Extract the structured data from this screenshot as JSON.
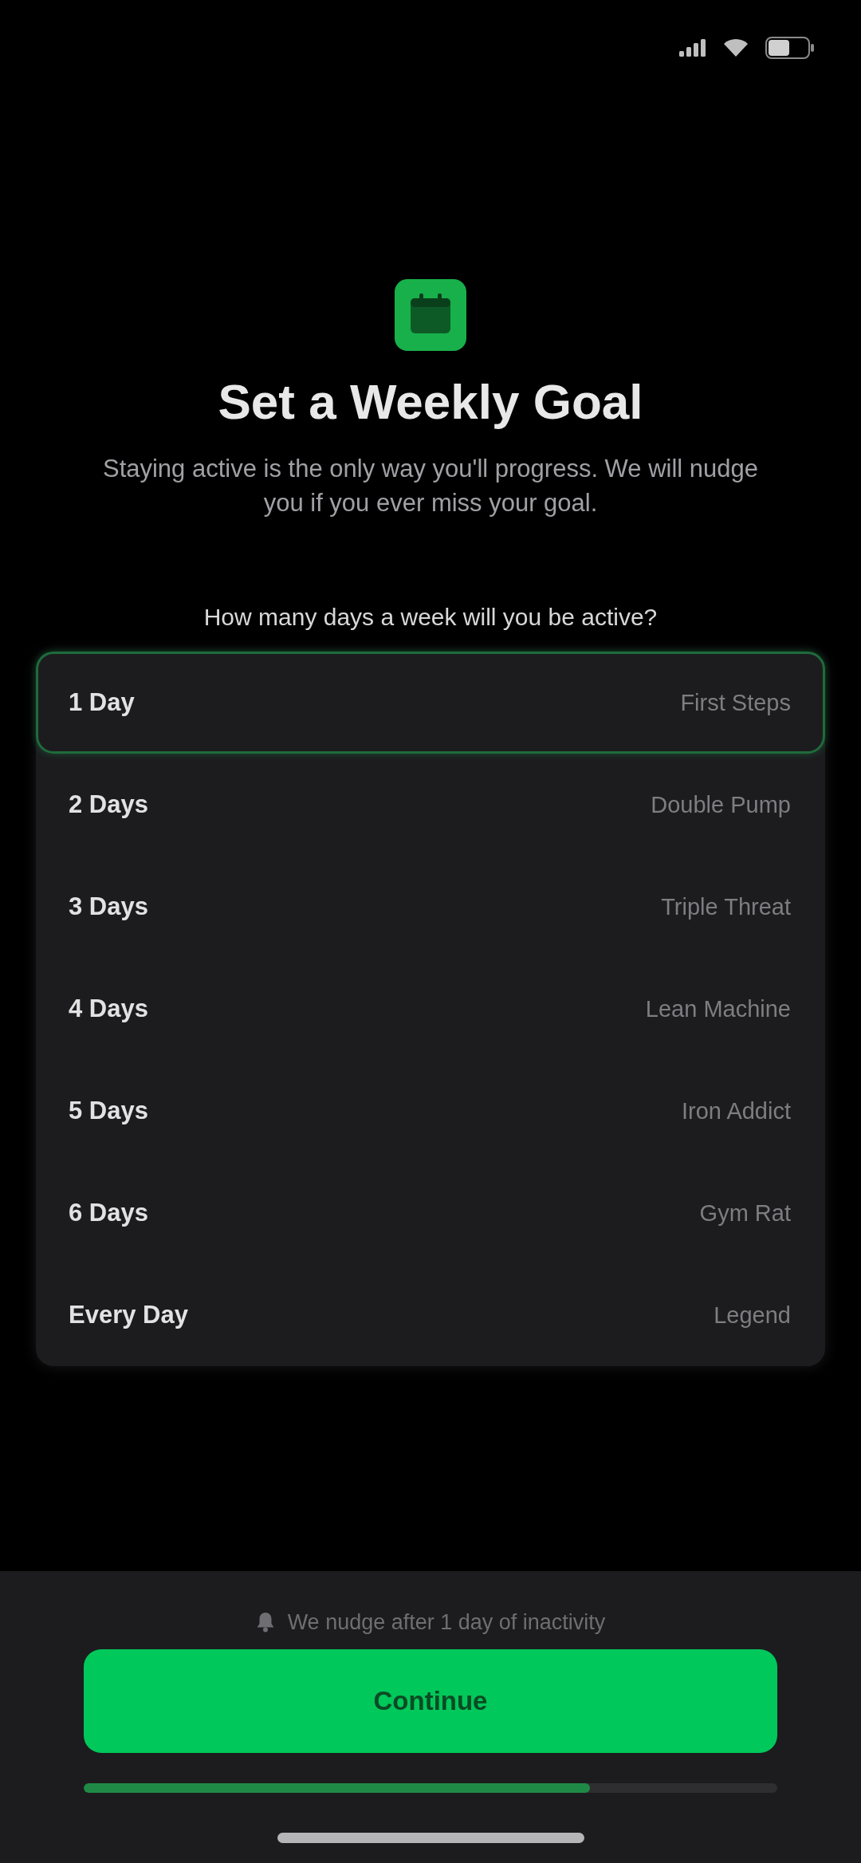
{
  "header": {
    "title": "Set a Weekly Goal",
    "subtitle": "Staying active is the only way you'll progress. We will nudge you if you ever miss your goal.",
    "question": "How many days a week will you be active?"
  },
  "options": [
    {
      "days": "1 Day",
      "name": "First Steps",
      "selected": true
    },
    {
      "days": "2 Days",
      "name": "Double Pump",
      "selected": false
    },
    {
      "days": "3 Days",
      "name": "Triple Threat",
      "selected": false
    },
    {
      "days": "4 Days",
      "name": "Lean Machine",
      "selected": false
    },
    {
      "days": "5 Days",
      "name": "Iron Addict",
      "selected": false
    },
    {
      "days": "6 Days",
      "name": "Gym Rat",
      "selected": false
    },
    {
      "days": "Every Day",
      "name": "Legend",
      "selected": false
    }
  ],
  "footer": {
    "note": "We nudge after 1 day of inactivity",
    "button": "Continue",
    "progress": {
      "level": 0.73
    }
  }
}
